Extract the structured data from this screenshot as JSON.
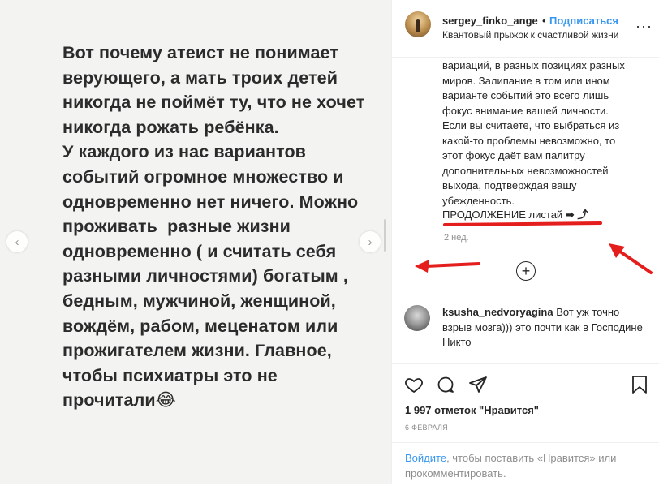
{
  "media": {
    "text": "Вот почему атеист не понимает верующего, а мать троих детей никогда не поймёт ту, что не хочет никогда рожать ребёнка.\nУ каждого из нас вариантов событий огромное множество и одновременно нет ничего. Можно проживать  разные жизни одновременно ( и считать себя разными личностями) богатым , бедным, мужчиной, женщиной, вождём, рабом, меценатом или прожигателем жизни. Главное, чтобы психиатры это не прочитали😂",
    "prev_icon": "chevron-left-icon",
    "next_icon": "chevron-right-icon"
  },
  "header": {
    "username": "sergey_finko_ange",
    "separator": "•",
    "follow_label": "Подписаться",
    "subtitle": "Квантовый прыжок к счастливой жизни",
    "more_icon": "more-icon"
  },
  "caption": {
    "text": "вариаций, в разных позициях разных миров. Залипание в том или ином варианте событий это всего лишь фокус внимание вашей личности. Если вы считаете, что выбраться из какой-то проблемы невозможно, то этот фокус даёт вам палитру дополнительных невозможностей выхода, подтверждая вашу убежденность.",
    "continue_text": "ПРОДОЛЖЕНИЕ листай",
    "continue_arrows": "➡ ⤴",
    "time": "2 нед."
  },
  "comment": {
    "username": "ksusha_nedvoryagina",
    "text": "Вот уж точно взрыв мозга))) это почти как в Господине Никто"
  },
  "actions": {
    "likes": "1 997 отметок \"Нравится\"",
    "date": "6 ФЕВРАЛЯ"
  },
  "login": {
    "link": "Войдите",
    "text": ", чтобы поставить «Нравится» или прокомментировать."
  },
  "colors": {
    "accent": "#3897f0",
    "annotation_red": "#e41d1d",
    "muted": "#8e8e8e"
  }
}
